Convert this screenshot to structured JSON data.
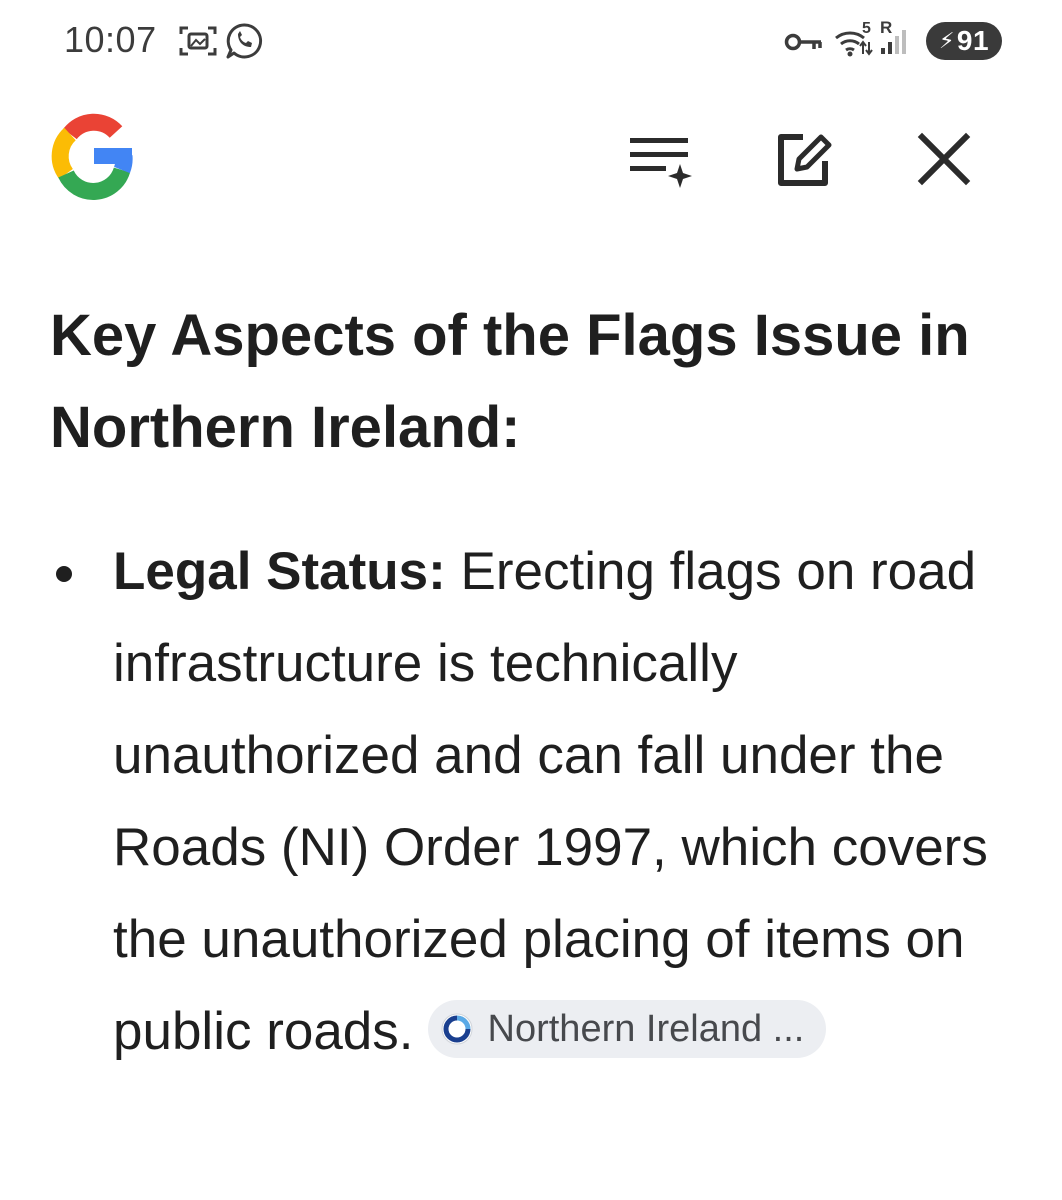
{
  "status_bar": {
    "time": "10:07",
    "network_label": "5",
    "roaming_label": "R",
    "battery_level": "91"
  },
  "header": {
    "logo": "google-g-logo",
    "actions": [
      "ai-summary-icon",
      "edit-icon",
      "close-icon"
    ]
  },
  "main": {
    "heading": "Key Aspects of the Flags Issue in Northern Ireland:",
    "bullets": [
      {
        "term": "Legal Status:",
        "text": " Erecting flags on road infrastructure is technically unauthorized and can fall under the Roads (NI) Order 1997, which covers the unauthorized placing of items on public roads.",
        "source_chip": "Northern Ireland ..."
      }
    ]
  },
  "colors": {
    "text": "#1f1f1f",
    "chip_bg": "#eceef2",
    "battery_bg": "#3a3a3a",
    "google_blue": "#4285F4",
    "google_red": "#EA4335",
    "google_yellow": "#FBBC05",
    "google_green": "#34A853"
  }
}
